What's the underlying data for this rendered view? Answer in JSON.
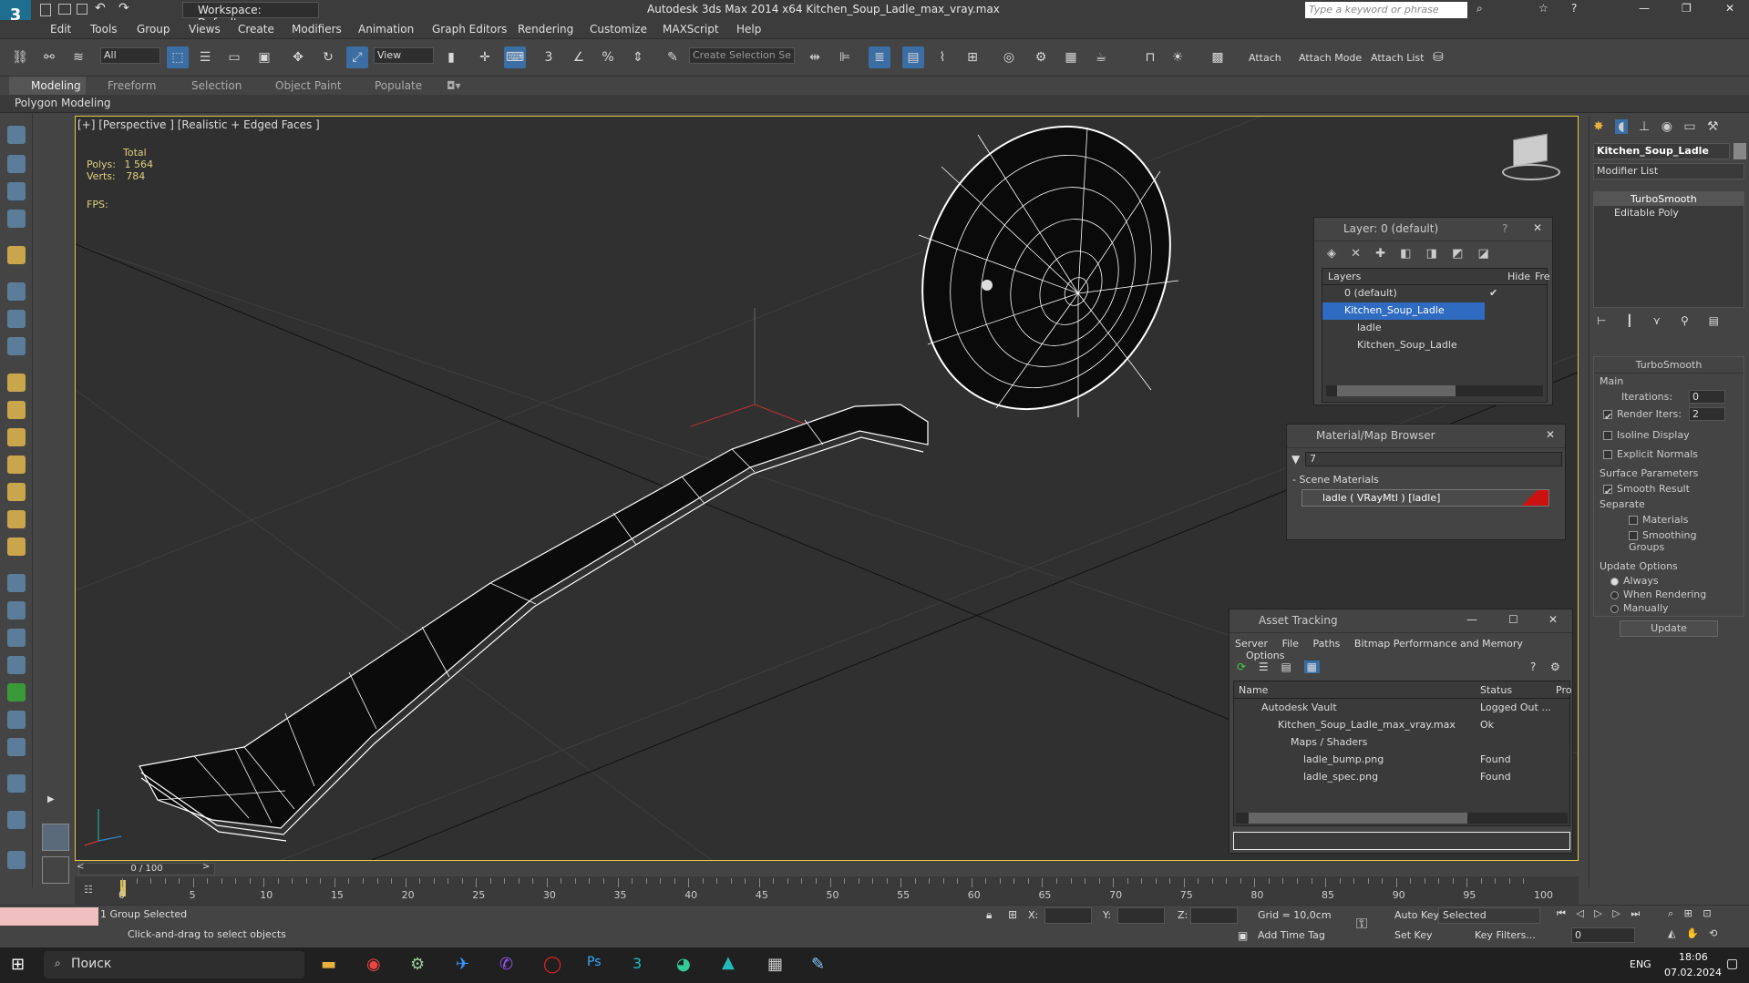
{
  "titlebar": {
    "workspace": "Workspace: Default",
    "title": "Autodesk 3ds Max  2014 x64     Kitchen_Soup_Ladle_max_vray.max",
    "search_placeholder": "Type a keyword or phrase"
  },
  "menu": [
    "Edit",
    "Tools",
    "Group",
    "Views",
    "Create",
    "Modifiers",
    "Animation",
    "Graph Editors",
    "Rendering",
    "Customize",
    "MAXScript",
    "Help"
  ],
  "toolbar": {
    "filter": "All",
    "view": "View",
    "selection_set": "Create Selection Se",
    "attach": "Attach",
    "attach_mode": "Attach Mode",
    "attach_list": "Attach List"
  },
  "ribbon": {
    "tabs": [
      "Modeling",
      "Freeform",
      "Selection",
      "Object Paint",
      "Populate"
    ],
    "sub": "Polygon Modeling"
  },
  "viewport": {
    "label": "[+] [Perspective ] [Realistic + Edged Faces ]",
    "total": "Total",
    "polys_label": "Polys:",
    "polys": "1 564",
    "verts_label": "Verts:",
    "verts": "784",
    "fps_label": "FPS:"
  },
  "layer": {
    "title": "Layer: 0 (default)",
    "help": "?",
    "col_layers": "Layers",
    "col_hide": "Hide",
    "col_freeze": "Fre",
    "rows": [
      "0 (default)",
      "Kitchen_Soup_Ladle",
      "ladle",
      "Kitchen_Soup_Ladle"
    ]
  },
  "material": {
    "title": "Material/Map Browser",
    "search": "7",
    "section": "- Scene Materials",
    "item": "ladle  ( VRayMtl )  [ladle]"
  },
  "asset": {
    "title": "Asset Tracking",
    "menu": [
      "Server",
      "File",
      "Paths",
      "Bitmap Performance and Memory",
      "Options"
    ],
    "col_name": "Name",
    "col_status": "Status",
    "col_pro": "Pro",
    "rows": [
      {
        "name": "Autodesk Vault",
        "status": "Logged Out ..."
      },
      {
        "name": "Kitchen_Soup_Ladle_max_vray.max",
        "status": "Ok"
      },
      {
        "name": "Maps / Shaders",
        "status": ""
      },
      {
        "name": "ladle_bump.png",
        "status": "Found"
      },
      {
        "name": "ladle_spec.png",
        "status": "Found"
      }
    ]
  },
  "command": {
    "object_name": "Kitchen_Soup_Ladle",
    "modifier_list": "Modifier List",
    "stack": [
      "TurboSmooth",
      "Editable Poly"
    ],
    "rollout": "TurboSmooth",
    "main": "Main",
    "iterations_label": "Iterations:",
    "iterations": "0",
    "render_iters_label": "Render Iters:",
    "render_iters": "2",
    "isoline": "Isoline Display",
    "explicit": "Explicit Normals",
    "surface": "Surface Parameters",
    "smooth_result": "Smooth Result",
    "separate": "Separate",
    "materials": "Materials",
    "smoothing_groups": "Smoothing Groups",
    "update_options": "Update Options",
    "always": "Always",
    "when_rendering": "When Rendering",
    "manually": "Manually",
    "update": "Update"
  },
  "timeline": {
    "frame": "0 / 100",
    "ticks": [
      "0",
      "5",
      "10",
      "15",
      "20",
      "25",
      "30",
      "35",
      "40",
      "45",
      "50",
      "55",
      "60",
      "65",
      "70",
      "75",
      "80",
      "85",
      "90",
      "95",
      "100"
    ]
  },
  "status": {
    "selected": "1 Group Selected",
    "prompt": "Click-and-drag to select objects",
    "x": "X:",
    "y": "Y:",
    "z": "Z:",
    "grid": "Grid = 10,0cm",
    "auto_key": "Auto Key",
    "selected_dd": "Selected",
    "set_key": "Set Key",
    "key_filters": "Key Filters...",
    "add_time_tag": "Add Time Tag",
    "frame": "0"
  },
  "taskbar": {
    "search": "Поиск",
    "lang": "ENG",
    "time": "18:06",
    "date": "07.02.2024"
  }
}
